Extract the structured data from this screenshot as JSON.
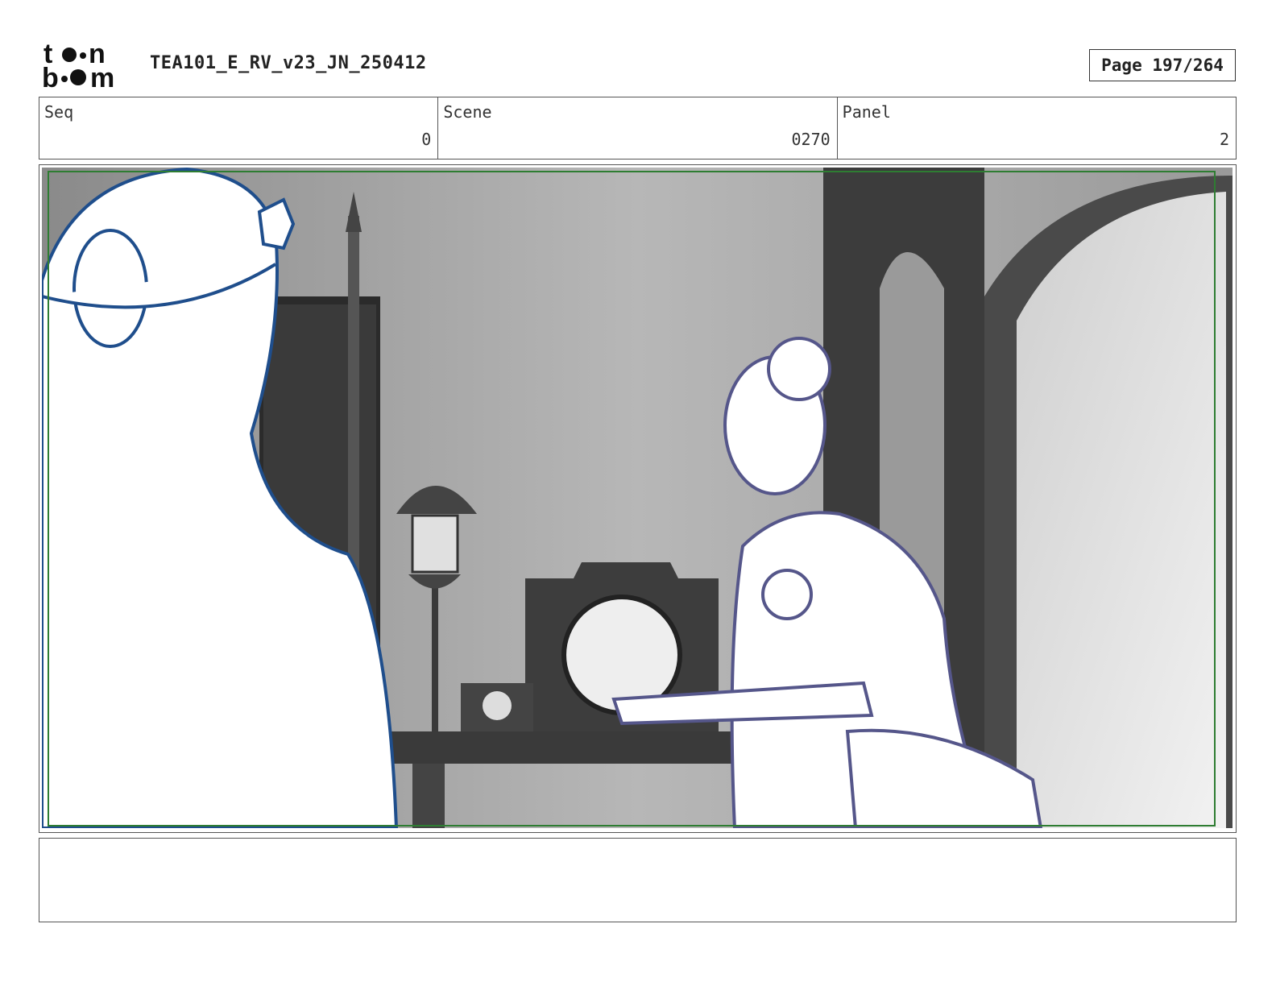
{
  "header": {
    "logo_text": "toon boom",
    "document_title": "TEA101_E_RV_v23_JN_250412",
    "page_indicator": "Page 197/264"
  },
  "info": {
    "seq_label": "Seq",
    "seq_value": "0",
    "scene_label": "Scene",
    "scene_value": "0270",
    "panel_label": "Panel",
    "panel_value": "2"
  },
  "colors": {
    "foreground_character_line": "#1f4e8c",
    "servant_character_line": "#55568a",
    "safe_frame": "#2e7d32",
    "background_tone": "#9e9e9e"
  },
  "notes": {
    "text": ""
  }
}
